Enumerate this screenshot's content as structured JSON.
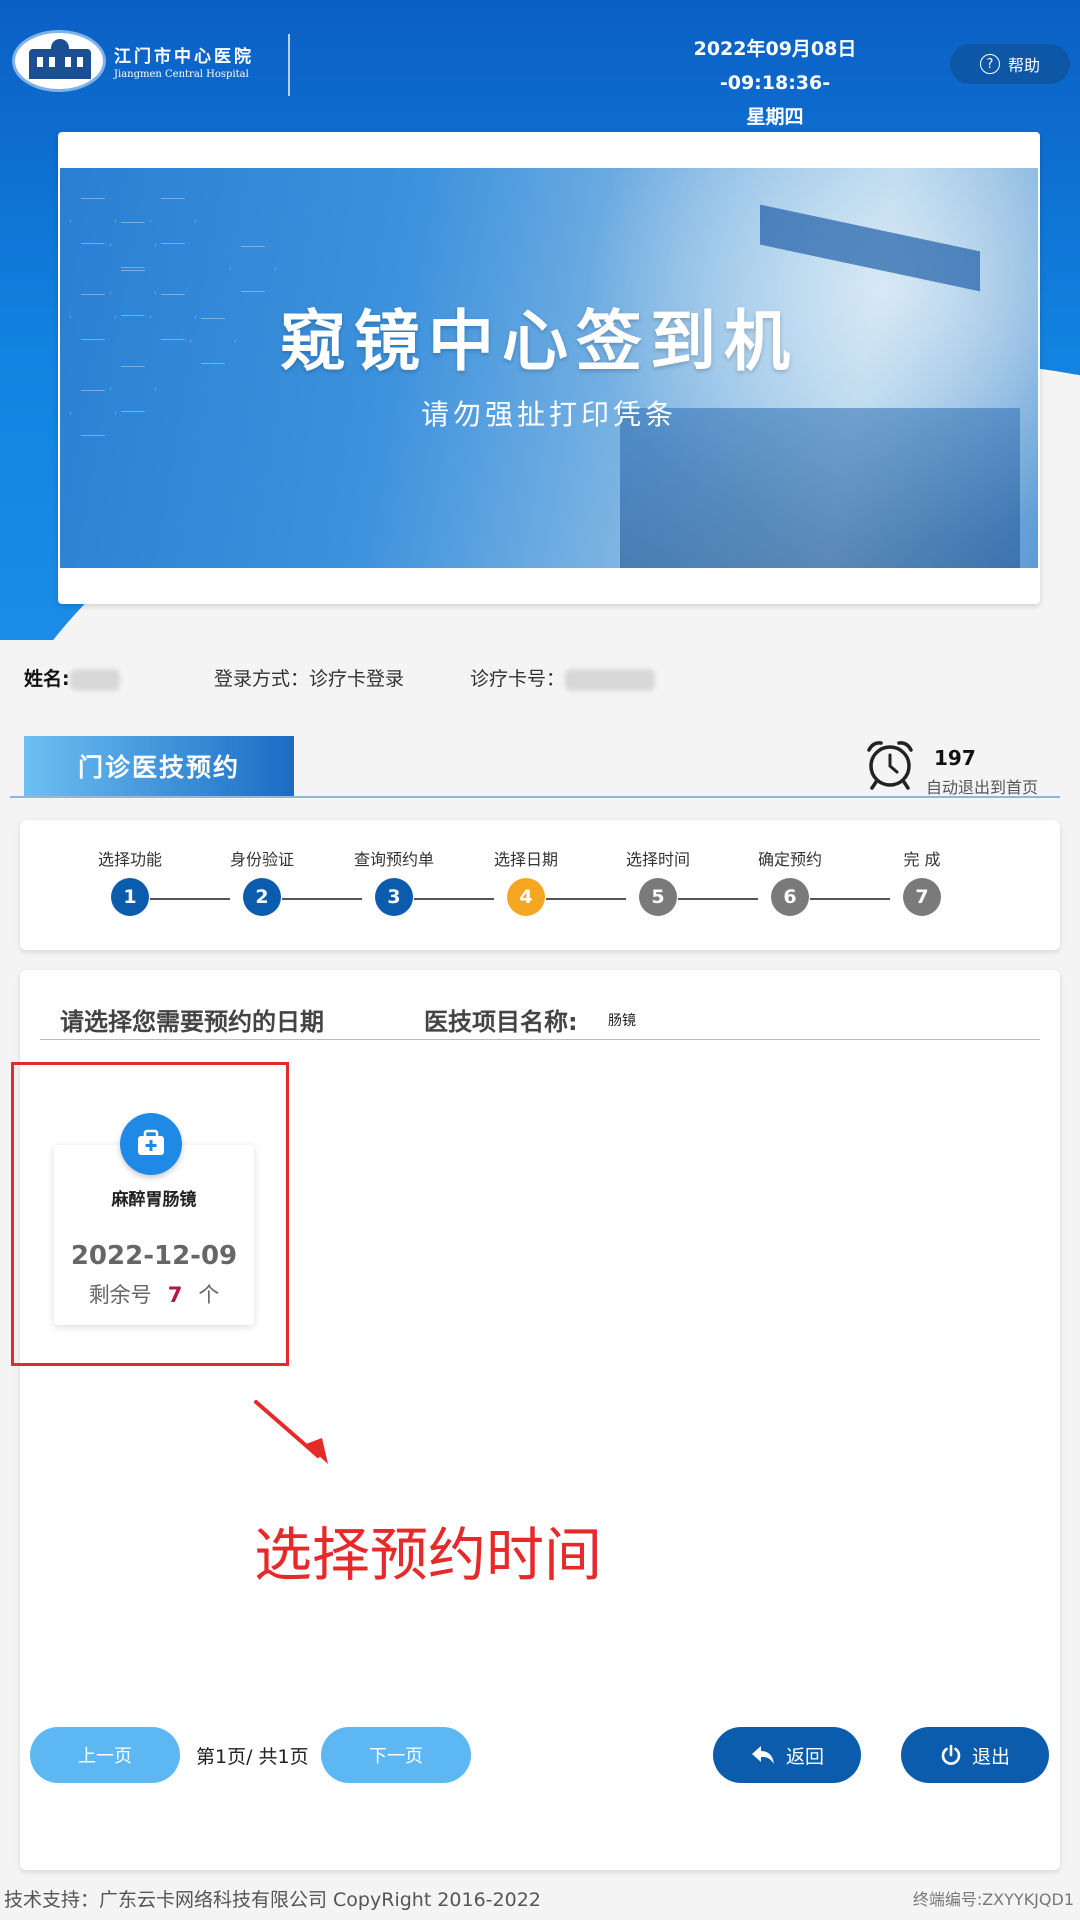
{
  "header": {
    "hospital_name_cn": "江门市中心医院",
    "hospital_name_en": "Jiangmen Central Hospital",
    "datetime": "2022年09月08日 -09:18:36-",
    "weekday": "星期四",
    "help_label": "帮助",
    "help_icon": "question-circle-icon"
  },
  "banner": {
    "title": "窥镜中心签到机",
    "subtitle": "请勿强扯打印凭条"
  },
  "patient": {
    "name_label": "姓名:",
    "login_method": "登录方式：诊疗卡登录",
    "card_label": "诊疗卡号："
  },
  "section": {
    "title": "门诊医技预约",
    "countdown": "197",
    "countdown_text": "自动退出到首页"
  },
  "steps": [
    {
      "label": "选择功能",
      "num": "1",
      "state": "done"
    },
    {
      "label": "身份验证",
      "num": "2",
      "state": "done"
    },
    {
      "label": "查询预约单",
      "num": "3",
      "state": "done"
    },
    {
      "label": "选择日期",
      "num": "4",
      "state": "current"
    },
    {
      "label": "选择时间",
      "num": "5",
      "state": "pending"
    },
    {
      "label": "确定预约",
      "num": "6",
      "state": "pending"
    },
    {
      "label": "完 成",
      "num": "7",
      "state": "pending"
    }
  ],
  "main": {
    "prompt": "请选择您需要预约的日期",
    "project_label": "医技项目名称:",
    "project_value": "肠镜",
    "date_card": {
      "icon": "medical-kit-icon",
      "name": "麻醉胃肠镜",
      "date": "2022-12-09",
      "remain_prefix": "剩余号",
      "remain_count": "7",
      "remain_suffix": "个"
    },
    "annotation": "选择预约时间"
  },
  "pagination": {
    "prev_label": "上一页",
    "page_info": "第1页/ 共1页",
    "next_label": "下一页"
  },
  "actions": {
    "back_label": "返回",
    "exit_label": "退出"
  },
  "footer": {
    "support": "技术支持：广东云卡网络科技有限公司 CopyRight 2016-2022",
    "terminal": "终端编号:ZXYYKJQD1"
  },
  "colors": {
    "header_blue": "#0b5fc4",
    "step_done": "#0b5cad",
    "step_current": "#f5a623",
    "step_pending": "#7a7a7a",
    "annotation_red": "#e62a2a",
    "button_light": "#5cb7f2",
    "button_dark": "#0b5cad"
  }
}
